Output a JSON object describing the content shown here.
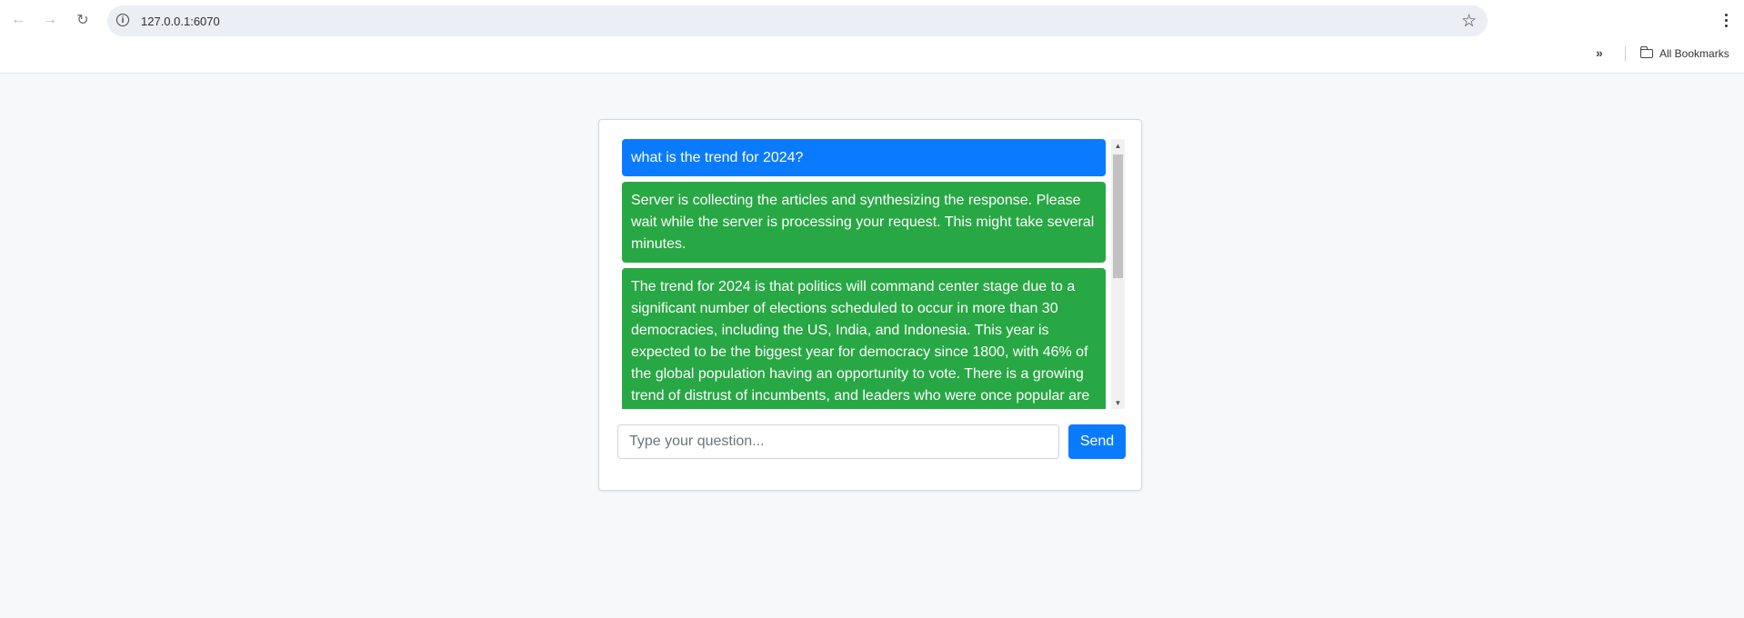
{
  "browser": {
    "url": "127.0.0.1:6070",
    "bookmarks_label": "All Bookmarks"
  },
  "chat": {
    "messages": [
      {
        "role": "user",
        "text": "what is the trend for 2024?"
      },
      {
        "role": "bot",
        "text": "Server is collecting the articles and synthesizing the response. Please wait while the server is processing your request. This might take several minutes."
      },
      {
        "role": "bot",
        "text": "The trend for 2024 is that politics will command center stage due to a significant number of elections scheduled to occur in more than 30 democracies, including the US, India, and Indonesia. This year is expected to be the biggest year for democracy since 1800, with 46% of the global population having an opportunity to vote. There is a growing trend of distrust of incumbents, and leaders who were once popular are"
      }
    ],
    "input_placeholder": "Type your question...",
    "input_value": "",
    "send_label": "Send"
  },
  "colors": {
    "user_bubble": "#0a7bff",
    "bot_bubble": "#28a745",
    "page_background": "#f7f8fa"
  }
}
